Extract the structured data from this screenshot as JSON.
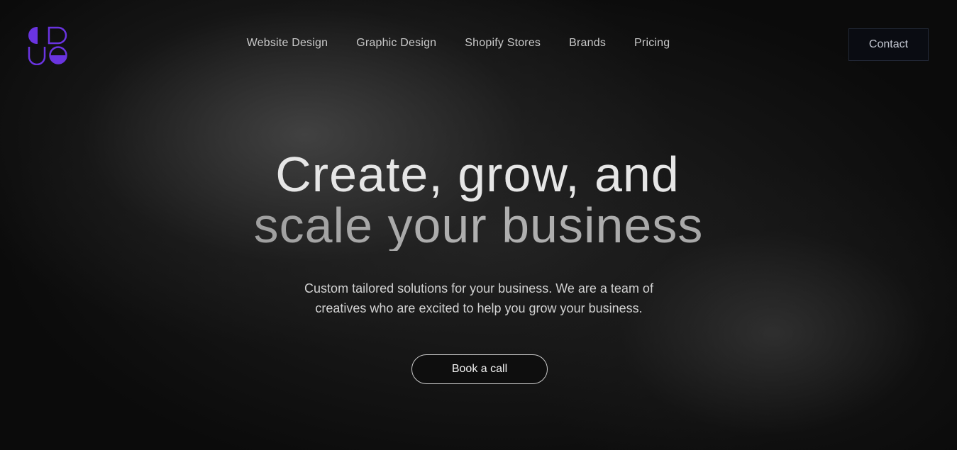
{
  "brand": {
    "logo_icon": "geometric-shapes-logo",
    "accent_color": "#6a34e0"
  },
  "nav": {
    "items": [
      {
        "label": "Website Design"
      },
      {
        "label": "Graphic Design"
      },
      {
        "label": "Shopify Stores"
      },
      {
        "label": "Brands"
      },
      {
        "label": "Pricing"
      }
    ],
    "contact_label": "Contact"
  },
  "hero": {
    "title_line1": "Create, grow, and",
    "title_line2": "scale your business",
    "subtitle": "Custom tailored solutions for your business. We are a team of creatives who are excited to help you grow your business.",
    "cta_label": "Book a call"
  }
}
